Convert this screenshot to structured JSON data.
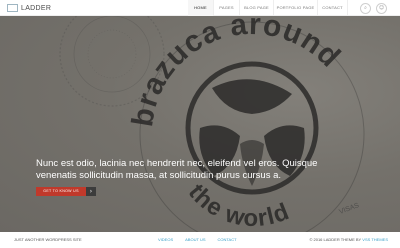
{
  "header": {
    "logo_text": "LADDER",
    "logo_icon": "logo-icon",
    "nav": [
      {
        "label": "HOME",
        "active": true
      },
      {
        "label": "PAGES",
        "active": false
      },
      {
        "label": "BLOG PAGE",
        "active": false
      },
      {
        "label": "PORTFOLIO PAGE",
        "active": false
      },
      {
        "label": "CONTACT",
        "active": false
      }
    ],
    "icons": [
      "search-icon",
      "user-icon"
    ]
  },
  "hero": {
    "stamp_text": "brazuca around the world",
    "stamp_corner_text": "VISAS",
    "caption": "Nunc est odio, lacinia nec hendrerit nec, eleifend vel eros. Quisque venenatis sollicitudin massa, at sollicitudin purus cursus a.",
    "cta_label": "GET TO KNOW US",
    "cta_arrow": "›"
  },
  "footer": {
    "tagline": "JUST ANOTHER WORDPRESS SITE",
    "links": [
      "VIDEOS",
      "ABOUT US",
      "CONTACT"
    ],
    "copyright_prefix": "© 2016 LADDER THEME BY",
    "copyright_link": "VSS THEMES"
  },
  "colors": {
    "accent": "#c0392b",
    "link": "#3aa0c8",
    "hero_bg": "#74716b"
  }
}
